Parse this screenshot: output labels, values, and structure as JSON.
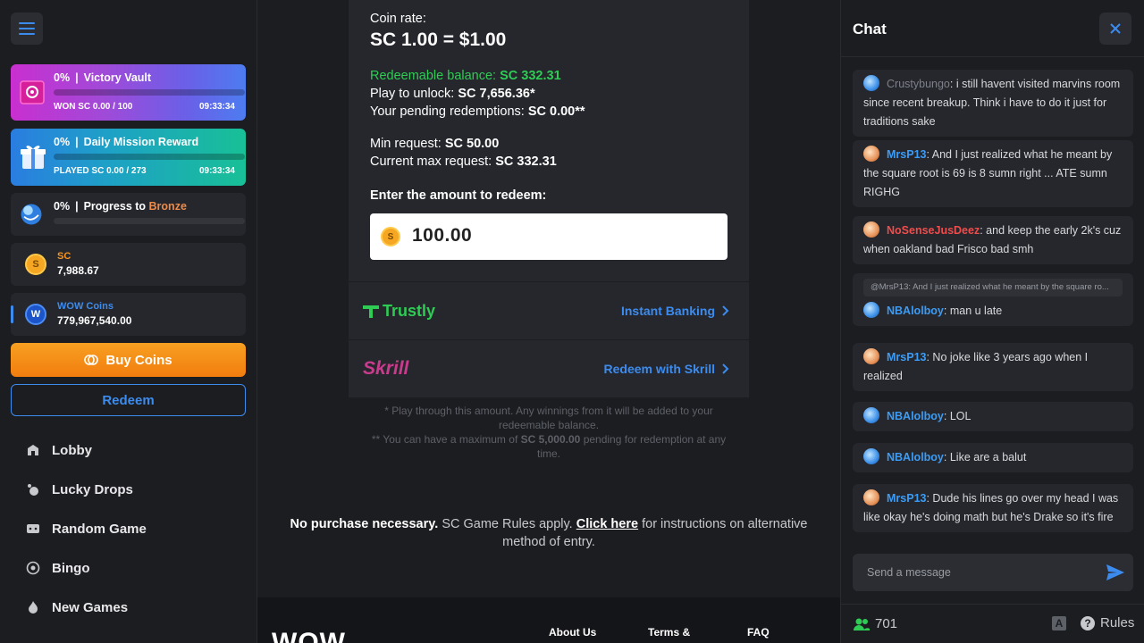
{
  "sidebar": {
    "vault": {
      "percent": "0%",
      "title": "Victory Vault",
      "sub": "WON SC 0.00 / 100",
      "time": "09:33:34",
      "progress": 0
    },
    "mission": {
      "percent": "0%",
      "title": "Daily Mission Reward",
      "sub": "PLAYED SC 0.00 / 273",
      "time": "09:33:34",
      "progress": 0
    },
    "tier": {
      "percent": "0%",
      "title": "Progress to",
      "tier_name": "Bronze",
      "progress": 0
    },
    "sc": {
      "symbol": "S",
      "label": "SC",
      "value": "7,988.67"
    },
    "wow": {
      "symbol": "W",
      "label": "WOW Coins",
      "value": "779,967,540.00"
    },
    "buy_label": "Buy Coins",
    "redeem_label": "Redeem",
    "nav": [
      {
        "label": "Lobby",
        "icon": "lobby-icon"
      },
      {
        "label": "Lucky Drops",
        "icon": "lucky-drops-icon"
      },
      {
        "label": "Random Game",
        "icon": "dice-icon"
      },
      {
        "label": "Bingo",
        "icon": "bingo-icon"
      },
      {
        "label": "New Games",
        "icon": "flame-icon"
      }
    ]
  },
  "redeem": {
    "coin_rate_label": "Coin rate:",
    "coin_rate_value": "SC 1.00 = $1.00",
    "redeemable_label": "Redeemable balance:",
    "redeemable_value": "SC 332.31",
    "unlock_label": "Play to unlock:",
    "unlock_value": "SC 7,656.36*",
    "pending_label": "Your pending redemptions:",
    "pending_value": "SC 0.00**",
    "min_label": "Min request:",
    "min_value": "SC 50.00",
    "max_label": "Current max request:",
    "max_value": "SC 332.31",
    "amount_label": "Enter the amount to redeem:",
    "amount_symbol": "S",
    "amount_value": "100.00",
    "trustly_name": "Trustly",
    "trustly_link": "Instant Banking",
    "skrill_name": "Skrill",
    "skrill_link": "Redeem with Skrill",
    "note1": "* Play through this amount. Any winnings from it will be added to your redeemable balance.",
    "note2_pre": "** You can have a maximum of",
    "note2_bold": "SC 5,000.00",
    "note2_post": "pending for redemption at any time.",
    "legal_bold": "No purchase necessary.",
    "legal_mid": "SC Game Rules apply.",
    "legal_link": "Click here",
    "legal_post": "for instructions on alternative method of entry."
  },
  "footer": {
    "logo": "WOW",
    "links": [
      "About Us",
      "Terms &",
      "FAQ"
    ]
  },
  "chat": {
    "title": "Chat",
    "messages": [
      {
        "user": "Crustybungo",
        "text": ": i still havent visited marvins room since recent breakup. Think i have to do it just for traditions sake"
      },
      {
        "user": "MrsP13",
        "text": ": And I just realized what he meant by the square root is 69 is 8 sumn right ... ATE sumn RIGHG"
      },
      {
        "user": "NoSenseJusDeez",
        "text": ": and keep the early 2k's cuz when oakland bad Frisco bad smh"
      },
      {
        "reply": "@MrsP13: And I just realized what he meant by the square ro...",
        "user": "NBAlolboy",
        "text": ": man u late"
      },
      {
        "user": "MrsP13",
        "text": ": No joke like 3 years ago when I realized"
      },
      {
        "user": "NBAlolboy",
        "text": ": LOL"
      },
      {
        "user": "NBAlolboy",
        "text": ": Like are a balut"
      },
      {
        "user": "MrsP13",
        "text": ": Dude his lines go over my head I was like okay he's doing math but he's Drake so it's fire"
      }
    ],
    "input_placeholder": "Send a message",
    "online_count": "701",
    "font_toggle": "A",
    "rules_label": "Rules"
  },
  "colors": {
    "accent_blue": "#3c8cf0",
    "accent_orange": "#f7941d",
    "green": "#2ecc55",
    "skrill": "#c93c8d",
    "bronze": "#ec8b4a"
  }
}
